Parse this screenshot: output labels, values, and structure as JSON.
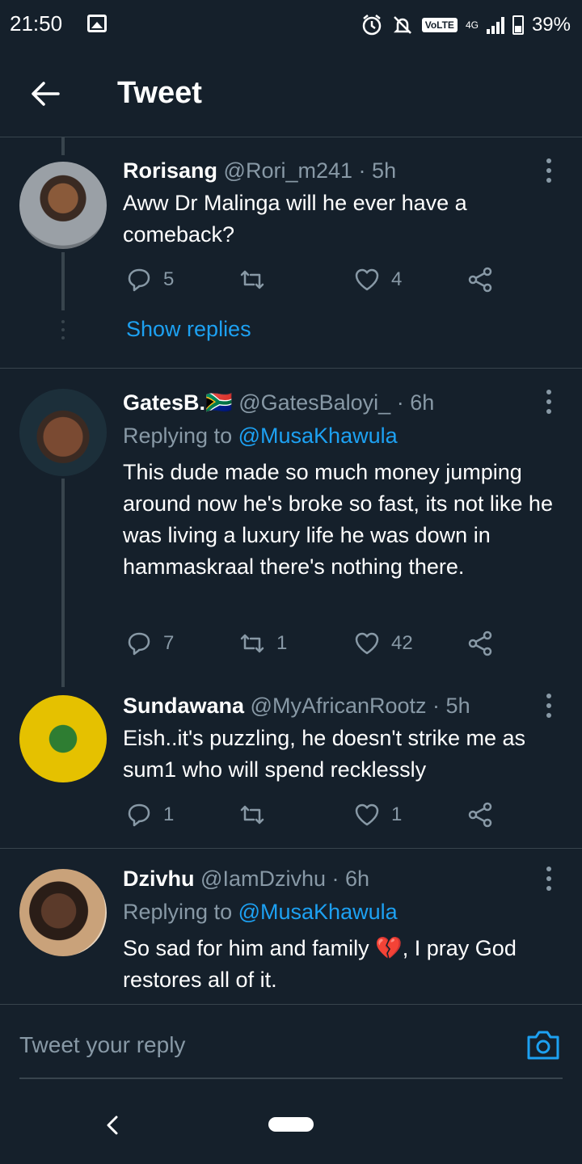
{
  "status": {
    "time": "21:50",
    "volte": "VoLTE",
    "network": "4G",
    "battery": "39%"
  },
  "header": {
    "title": "Tweet"
  },
  "tweets": [
    {
      "name": "Rorisang",
      "handle": "@Rori_m241",
      "time": "5h",
      "text": "Aww Dr Malinga will he ever have a comeback?",
      "replies": "5",
      "retweets": "",
      "likes": "4",
      "show_replies": "Show replies"
    },
    {
      "name": "GatesB.",
      "flag": "🇿🇦",
      "handle": "@GatesBaloyi_",
      "time": "6h",
      "replying_prefix": "Replying to",
      "replying_to": "@MusaKhawula",
      "text": "This dude made so much money jumping around now he's broke so fast, its not like he was living a luxury life he was down in hammaskraal there's nothing there.",
      "replies": "7",
      "retweets": "1",
      "likes": "42"
    },
    {
      "name": "Sundawana",
      "handle": "@MyAfricanRootz",
      "time": "5h",
      "text": "Eish..it's puzzling, he doesn't  strike me as sum1 who will spend recklessly",
      "replies": "1",
      "retweets": "",
      "likes": "1"
    },
    {
      "name": "Dzivhu",
      "handle": "@IamDzivhu",
      "time": "6h",
      "replying_prefix": "Replying to",
      "replying_to": "@MusaKhawula",
      "text_before": "So sad for him and family ",
      "emoji": "💔",
      "text_after": ", I pray God restores all of it."
    }
  ],
  "reply_bar": {
    "placeholder": "Tweet your reply"
  },
  "colors": {
    "background": "#15202b",
    "accent": "#1da1f2",
    "muted": "#8899a6",
    "divider": "#38444d"
  }
}
